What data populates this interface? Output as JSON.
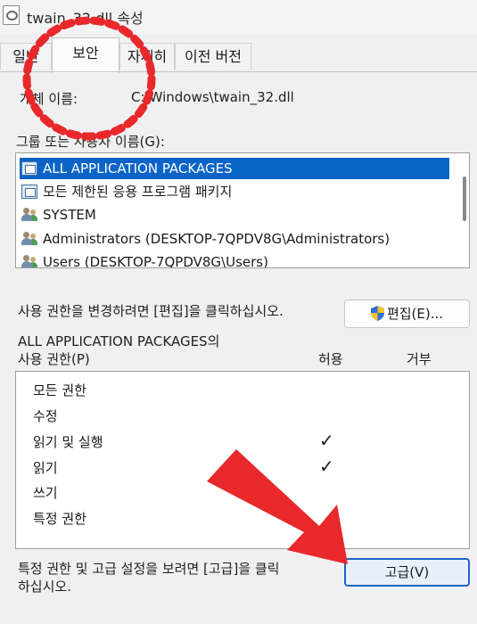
{
  "window": {
    "title": "twain_32.dll 속성"
  },
  "tabs": [
    {
      "label": "일반"
    },
    {
      "label": "보안"
    },
    {
      "label": "자세히"
    },
    {
      "label": "이전 버전"
    }
  ],
  "object": {
    "label": "개체 이름:",
    "value": "C:\\Windows\\twain_32.dll"
  },
  "groups": {
    "label": "그룹 또는 사용자 이름(G):",
    "items": [
      {
        "label": "ALL APPLICATION PACKAGES",
        "icon": "package-icon",
        "selected": true
      },
      {
        "label": "모든 제한된 응용 프로그램 패키지",
        "icon": "package-icon",
        "selected": false
      },
      {
        "label": "SYSTEM",
        "icon": "users-icon",
        "selected": false
      },
      {
        "label": "Administrators (DESKTOP-7QPDV8G\\Administrators)",
        "icon": "users-icon",
        "selected": false
      },
      {
        "label": "Users (DESKTOP-7QPDV8G\\Users)",
        "icon": "users-icon",
        "selected": false
      }
    ]
  },
  "edit": {
    "hint": "사용 권한을 변경하려면 [편집]을 클릭하십시오.",
    "button_label": "편집(E)..."
  },
  "permissions": {
    "header_line1": "ALL APPLICATION PACKAGES의",
    "header_line2": "사용 권한(P)",
    "allow_label": "허용",
    "deny_label": "거부",
    "rows": [
      {
        "label": "모든 권한",
        "allow": false,
        "deny": false
      },
      {
        "label": "수정",
        "allow": false,
        "deny": false
      },
      {
        "label": "읽기 및 실행",
        "allow": true,
        "deny": false
      },
      {
        "label": "읽기",
        "allow": true,
        "deny": false
      },
      {
        "label": "쓰기",
        "allow": false,
        "deny": false
      },
      {
        "label": "특정 권한",
        "allow": false,
        "deny": false
      }
    ],
    "check_glyph": "✓"
  },
  "advanced": {
    "hint_line1": "특정 권한 및 고급 설정을 보려면 [고급]을 클릭",
    "hint_line2": "하십시오.",
    "button_label": "고급(V)"
  },
  "colors": {
    "selection": "#0a64c8",
    "annotation_red": "#e8282a",
    "primary_button_border": "#1f63c6"
  }
}
